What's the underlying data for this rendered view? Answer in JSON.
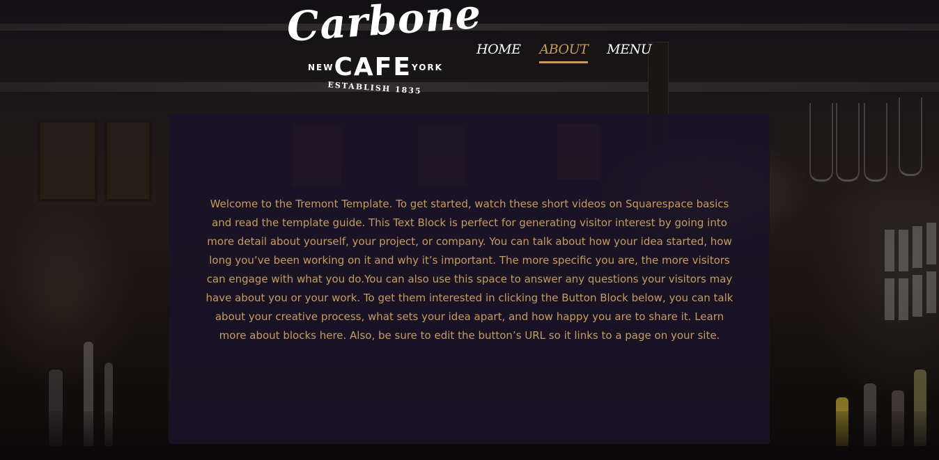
{
  "logo": {
    "script": "Carbone",
    "left_word": "NEW",
    "main_word": "CAFE",
    "right_word": "YORK",
    "tagline": "ESTABLISH 1835"
  },
  "nav": {
    "items": [
      {
        "label": "HOME",
        "active": false
      },
      {
        "label": "ABOUT",
        "active": true
      },
      {
        "label": "MENU",
        "active": false
      }
    ]
  },
  "content": {
    "body": "Welcome to the Tremont Template. To get started, watch these short videos on Squarespace basics and read the template guide. This Text Block is perfect for generating visitor interest by going into more detail about yourself, your project, or company. You can talk about how your idea started, how long you’ve been working on it and why it’s important. The more specific you are, the more visitors can engage with what you do.You can also use this space to answer any questions your visitors may have about you or your work. To get them interested in clicking the Button Block below, you can talk about your creative process, what sets your idea apart, and how happy you are to share it. Learn more about blocks here. Also, be sure to edit the button’s URL so it links to a page on your site."
  },
  "colors": {
    "accent": "#c89b5a",
    "panel": "#1a1328",
    "nav_text": "#ffffff"
  }
}
